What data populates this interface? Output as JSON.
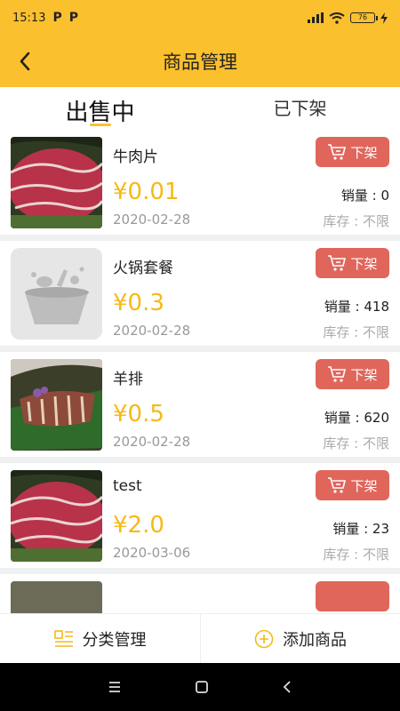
{
  "status_bar": {
    "time": "15:13",
    "badges": [
      "P",
      "P"
    ],
    "battery": "76"
  },
  "header": {
    "title": "商品管理"
  },
  "tabs": [
    {
      "label": "出售中",
      "active": true
    },
    {
      "label": "已下架",
      "active": false
    }
  ],
  "products": [
    {
      "name": "牛肉片",
      "price": "¥0.01",
      "date": "2020-02-28",
      "sales": "销量 : 0",
      "stock": "库存 : 不限",
      "action": "下架",
      "image": "raw-beef-slices"
    },
    {
      "name": "火锅套餐",
      "price": "¥0.3",
      "date": "2020-02-28",
      "sales": "销量 : 418",
      "stock": "库存 : 不限",
      "action": "下架",
      "image": "placeholder-bowl-icon"
    },
    {
      "name": "羊排",
      "price": "¥0.5",
      "date": "2020-02-28",
      "sales": "销量 : 620",
      "stock": "库存 : 不限",
      "action": "下架",
      "image": "lamb-ribs"
    },
    {
      "name": "test",
      "price": "¥2.0",
      "date": "2020-03-06",
      "sales": "销量 : 23",
      "stock": "库存 : 不限",
      "action": "下架",
      "image": "raw-beef-slices"
    }
  ],
  "bottom_bar": {
    "category_label": "分类管理",
    "add_label": "添加商品"
  },
  "colors": {
    "accent": "#fbc02d",
    "price": "#f6b915",
    "action": "#e0665c"
  }
}
